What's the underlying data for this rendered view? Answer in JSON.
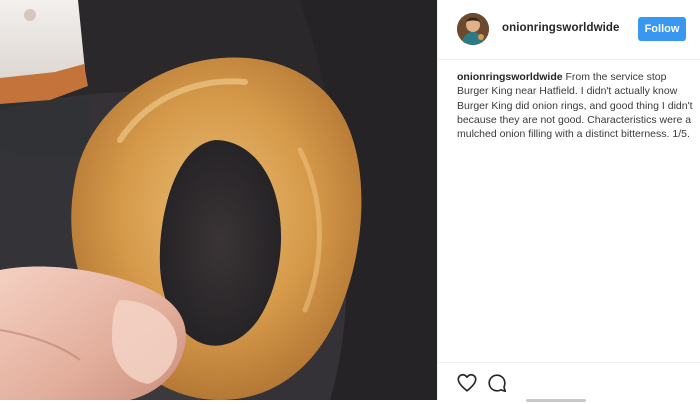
{
  "post": {
    "username": "onionringsworldwide",
    "follow_label": "Follow",
    "caption_username": "onionringsworldwide",
    "caption_text": "From the service stop Burger King near Hatfield. I didn't actually know Burger King did onion rings, and good thing I didn't because they are not good. Characteristics were a mulched onion filling with a distinct bitterness. 1/5."
  },
  "actions": {
    "icons": [
      "heart-icon",
      "comment-icon"
    ]
  },
  "colors": {
    "follow_button": "#3897f0",
    "text": "#262626",
    "divider": "#efefef",
    "onion_ring": "#d89a45"
  }
}
